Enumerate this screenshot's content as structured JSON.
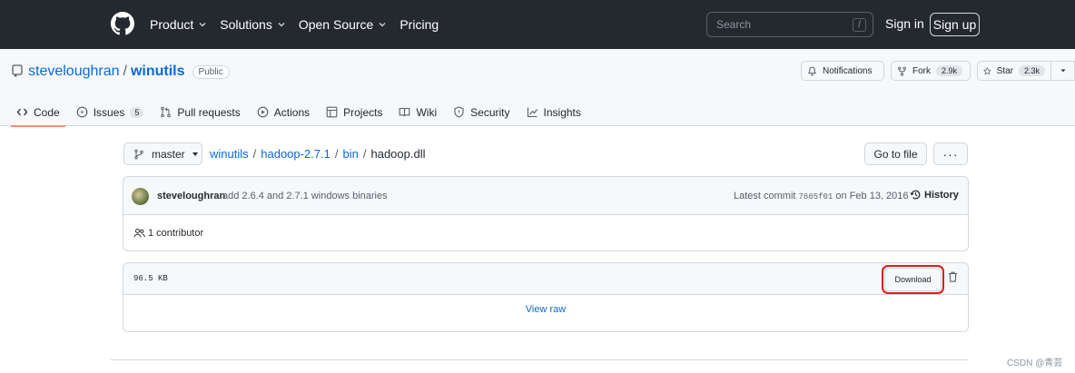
{
  "header": {
    "logo_icon": "github-mark-icon",
    "nav": [
      {
        "label": "Product",
        "has_dropdown": true
      },
      {
        "label": "Solutions",
        "has_dropdown": true
      },
      {
        "label": "Open Source",
        "has_dropdown": true
      },
      {
        "label": "Pricing",
        "has_dropdown": false
      }
    ],
    "search_placeholder": "Search",
    "search_shortcut": "/",
    "sign_in": "Sign in",
    "sign_up": "Sign up"
  },
  "repo": {
    "owner": "steveloughran",
    "separator": "/",
    "name": "winutils",
    "visibility": "Public",
    "notifications_label": "Notifications",
    "fork_label": "Fork",
    "fork_count": "2.9k",
    "star_label": "Star",
    "star_count": "2.3k"
  },
  "tabs": [
    {
      "label": "Code",
      "icon": "code-icon",
      "selected": true
    },
    {
      "label": "Issues",
      "icon": "issue-opened-icon",
      "count": "5"
    },
    {
      "label": "Pull requests",
      "icon": "git-pull-request-icon"
    },
    {
      "label": "Actions",
      "icon": "play-icon"
    },
    {
      "label": "Projects",
      "icon": "table-icon"
    },
    {
      "label": "Wiki",
      "icon": "book-icon"
    },
    {
      "label": "Security",
      "icon": "shield-icon"
    },
    {
      "label": "Insights",
      "icon": "graph-icon"
    }
  ],
  "file": {
    "branch": "master",
    "path": [
      "winutils",
      "hadoop-2.7.1",
      "bin"
    ],
    "path_sep": "/",
    "current": "hadoop.dll",
    "goto_file": "Go to file",
    "more": "···",
    "commit_author": "steveloughran",
    "commit_message": "add 2.6.4 and 2.7.1 windows binaries",
    "latest_commit_label": "Latest commit",
    "commit_sha": "7665f01",
    "commit_date": "on Feb 13, 2016",
    "history_label": "History",
    "contributors": "1 contributor",
    "size": "96.5 KB",
    "download_label": "Download",
    "view_raw": "View raw"
  },
  "colors": {
    "header_bg": "#24292f",
    "link": "#0969da",
    "tab_underline": "#fd8c73",
    "highlight": "#e01b1b"
  },
  "watermark": "CSDN @青芸"
}
